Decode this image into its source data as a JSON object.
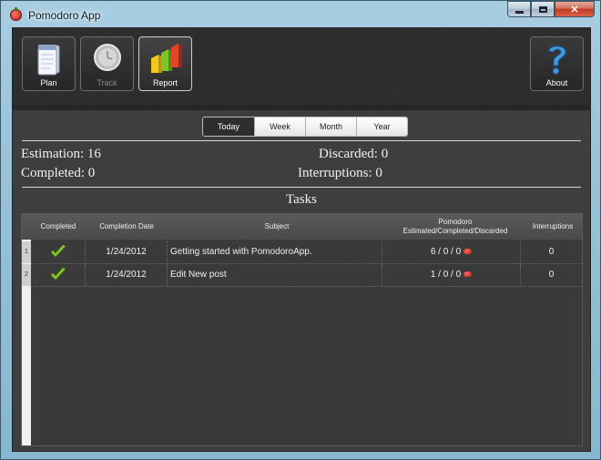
{
  "window": {
    "title": "Pomodoro App"
  },
  "toolbar": {
    "plan_label": "Plan",
    "track_label": "Track",
    "report_label": "Report",
    "about_label": "About"
  },
  "period_tabs": [
    "Today",
    "Week",
    "Month",
    "Year"
  ],
  "active_period": "Today",
  "stats": {
    "estimation": "Estimation: 16",
    "completed": "Completed: 0",
    "discarded": "Discarded: 0",
    "interruptions": "Interruptions: 0"
  },
  "tasks_title": "Tasks",
  "table": {
    "columns": {
      "completed": "Completed",
      "completion_date": "Completion Date",
      "subject": "Subject",
      "pomodoro": "Pomodoro",
      "pomodoro_sub": "Estimated/Completed/Discarded",
      "interruptions": "Interruptions"
    },
    "rows": [
      {
        "num": "1",
        "date": "1/24/2012",
        "subject": "Getting started with PomodoroApp.",
        "pomodoro": "6 / 0 / 0",
        "interruptions": "0"
      },
      {
        "num": "2",
        "date": "1/24/2012",
        "subject": "Edit New post",
        "pomodoro": "1 / 0 / 0",
        "interruptions": "0"
      }
    ]
  },
  "colors": {
    "accent": "#2e2e2e",
    "background": "#3e3e3e",
    "check": "#8fd12a",
    "tomato": "#c3281c"
  }
}
